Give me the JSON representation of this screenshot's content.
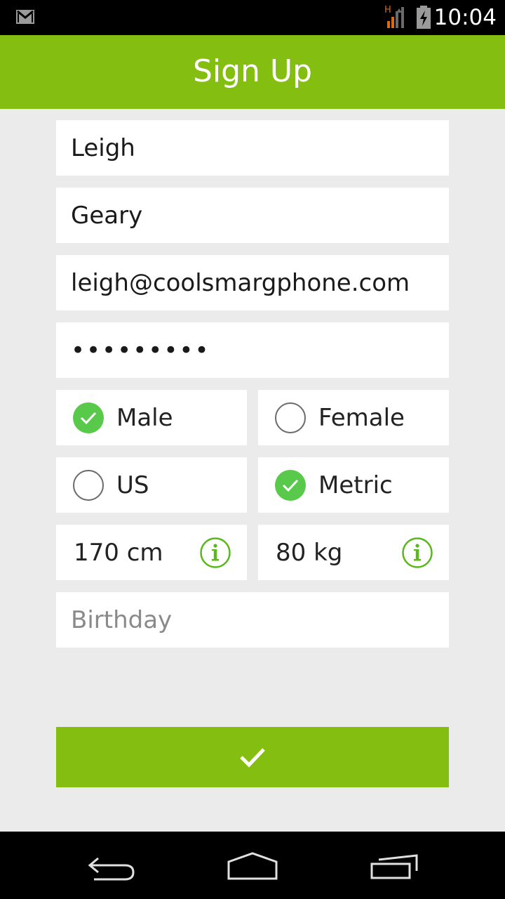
{
  "status_bar": {
    "time": "10:04",
    "network_label": "H",
    "icons": [
      "gmail-icon",
      "signal-icon",
      "battery-icon"
    ]
  },
  "app_bar": {
    "title": "Sign Up"
  },
  "form": {
    "first_name": {
      "value": "Leigh"
    },
    "last_name": {
      "value": "Geary"
    },
    "email": {
      "value": "leigh@coolsmargphone.com"
    },
    "password": {
      "value": "•••••••••"
    },
    "gender": {
      "options": [
        {
          "label": "Male",
          "selected": true
        },
        {
          "label": "Female",
          "selected": false
        }
      ]
    },
    "units": {
      "options": [
        {
          "label": "US",
          "selected": false
        },
        {
          "label": "Metric",
          "selected": true
        }
      ]
    },
    "height": {
      "value": "170 cm",
      "icon": "info-icon"
    },
    "weight": {
      "value": "80 kg",
      "icon": "info-icon"
    },
    "birthday": {
      "value": "",
      "placeholder": "Birthday"
    }
  },
  "submit": {
    "icon": "checkmark-icon"
  },
  "nav_bar": {
    "icons": [
      "back-icon",
      "home-icon",
      "recents-icon"
    ]
  },
  "colors": {
    "accent": "#84be10",
    "check": "#58c94a",
    "background": "#ebebeb"
  }
}
